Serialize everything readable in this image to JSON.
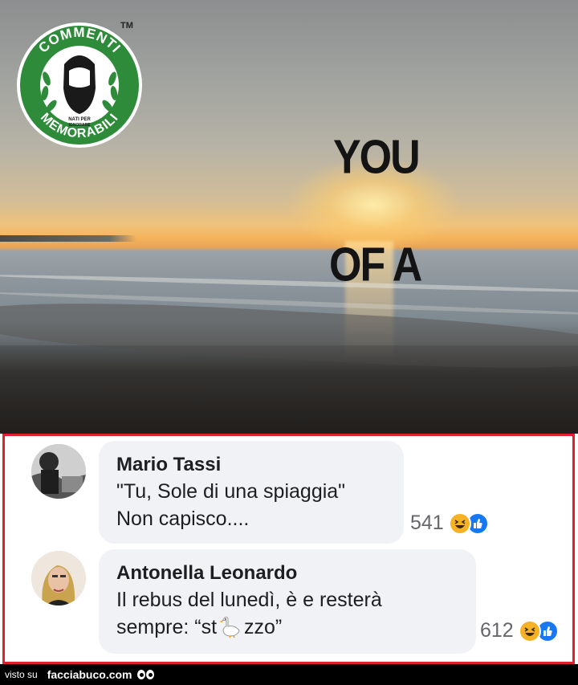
{
  "photo": {
    "text_line1": "YOU",
    "text_line2": "OF A"
  },
  "logo": {
    "top_text": "COMMENTI",
    "bottom_text": "MEMORABILI",
    "center_text": "NATI PER IGNORARE",
    "tm": "TM",
    "colors": {
      "ring": "#2e8b3a",
      "inner": "#ffffff"
    }
  },
  "comments": [
    {
      "author": "Mario Tassi",
      "lines": [
        "\"Tu, Sole di una spiaggia\"",
        "Non capisco...."
      ],
      "reaction_count": "541",
      "reaction_icons": [
        "haha-icon",
        "like-icon"
      ]
    },
    {
      "author": "Antonella Leonardo",
      "line1": "Il rebus del lunedì, è e resterà",
      "line2_before": "sempre: “st",
      "line2_after": "zzo”",
      "reaction_count": "612",
      "reaction_icons": [
        "haha-icon",
        "like-icon"
      ]
    }
  ],
  "footer": {
    "visto_su": "visto su",
    "brand": "facciabuco.com"
  },
  "colors": {
    "frame": "#e0202a",
    "bubble": "#f0f2f5",
    "like": "#1877f2",
    "haha": "#f7b125"
  }
}
